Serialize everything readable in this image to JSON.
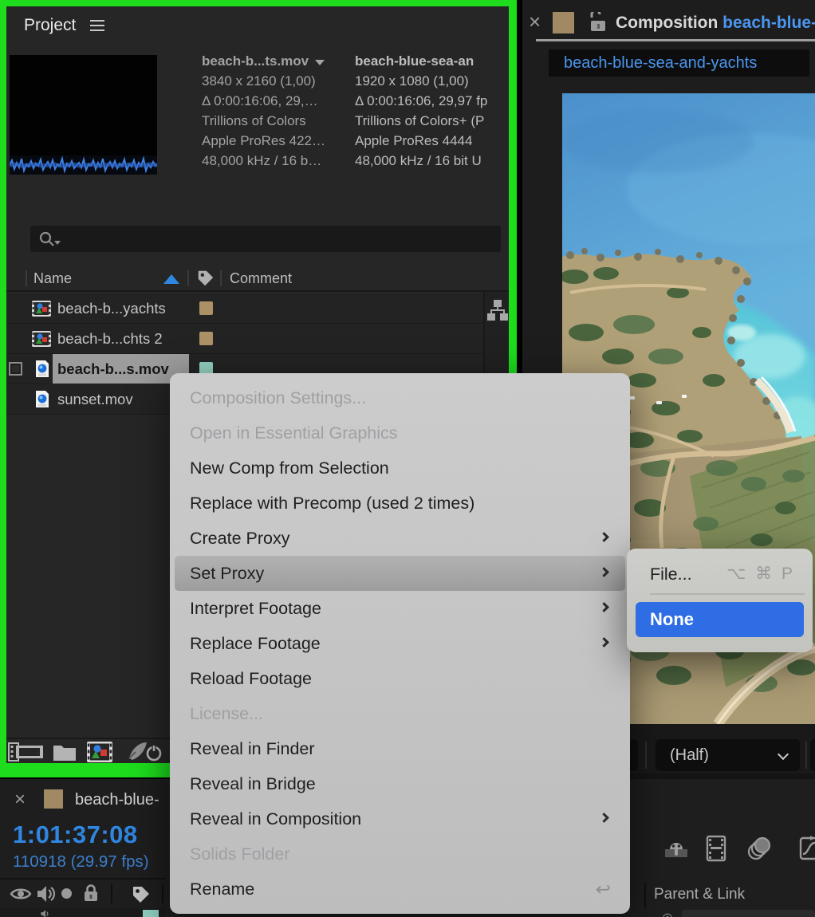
{
  "colors": {
    "focus_border_green": "#1ddd1d",
    "accent_blue": "#4a96f0",
    "timecode_blue": "#2f87e2",
    "menu_highlight_blue": "#2e6de4",
    "label_tan": "#a18a63",
    "label_teal": "#8fd0c0",
    "selected_row_gray": "#9c9c9c"
  },
  "project_panel": {
    "title": "Project",
    "preview": {
      "col1": [
        "beach-b...ts.mov",
        "3840 x 2160 (1,00)",
        "Δ 0:00:16:06, 29,…",
        "Trillions of Colors",
        "Apple ProRes 422…",
        "48,000 kHz / 16 b…"
      ],
      "col2": [
        "beach-blue-sea-an",
        "1920 x 1080 (1,00)",
        "Δ 0:00:16:06, 29,97 fp",
        "Trillions of Colors+ (P",
        "Apple ProRes 4444",
        "48,000 kHz / 16 bit U"
      ]
    },
    "search": {
      "placeholder": ""
    },
    "columns": {
      "name": "Name",
      "comment": "Comment"
    },
    "items": [
      {
        "name": "beach-b...yachts",
        "type": "composition",
        "label_color": "#ac9166"
      },
      {
        "name": "beach-b...chts 2",
        "type": "composition",
        "label_color": "#ac9166"
      },
      {
        "name": "beach-b...s.mov",
        "type": "footage",
        "label_color": "#93d1c1",
        "selected": true
      },
      {
        "name": "sunset.mov",
        "type": "footage"
      }
    ]
  },
  "composition_panel": {
    "close": "×",
    "header_label": "Composition",
    "header_comp_name": "beach-blue-",
    "tab_name": "beach-blue-sea-and-yachts",
    "magnification": "(Half)"
  },
  "timeline_panel": {
    "close": "×",
    "tab_name": "beach-blue-",
    "timecode": "1:01:37:08",
    "frame_info": "110918 (29.97 fps)",
    "parent_link_header": "Parent & Link"
  },
  "context_menu": {
    "items": [
      {
        "label": "Composition Settings...",
        "disabled": true
      },
      {
        "label": "Open in Essential Graphics",
        "disabled": true
      },
      {
        "label": "New Comp from Selection"
      },
      {
        "label": "Replace with Precomp (used 2 times)"
      },
      {
        "label": "Create Proxy",
        "submenu": true
      },
      {
        "label": "Set Proxy",
        "submenu": true,
        "highlighted": true
      },
      {
        "label": "Interpret Footage",
        "submenu": true
      },
      {
        "label": "Replace Footage",
        "submenu": true
      },
      {
        "label": "Reload Footage"
      },
      {
        "label": "License...",
        "disabled": true
      },
      {
        "label": "Reveal in Finder"
      },
      {
        "label": "Reveal in Bridge"
      },
      {
        "label": "Reveal in Composition",
        "submenu": true
      },
      {
        "label": "Solids Folder",
        "disabled": true
      },
      {
        "label": "Rename",
        "shortcut": "↩"
      }
    ]
  },
  "submenu": {
    "items": [
      {
        "label": "File...",
        "shortcut": "⌥ ⌘ P"
      },
      {
        "label": "None",
        "selected": true
      }
    ]
  }
}
